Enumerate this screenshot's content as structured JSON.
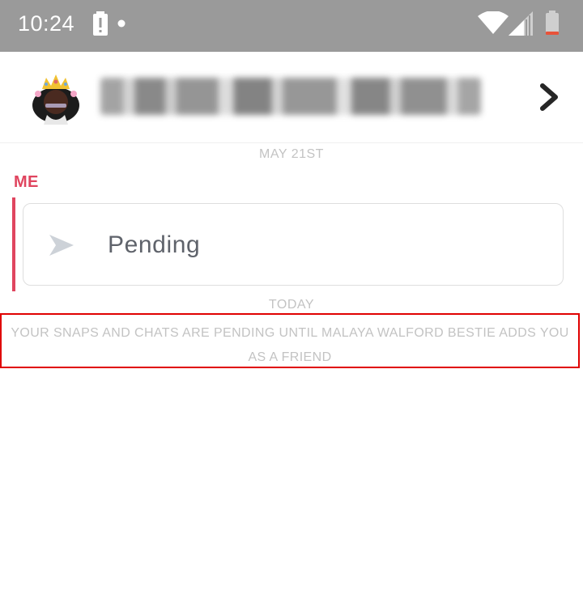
{
  "status_bar": {
    "time": "10:24",
    "icons": [
      "battery-alert-icon",
      "notification-dot-icon",
      "wifi-icon",
      "signal-icon",
      "battery-icon"
    ]
  },
  "header": {
    "avatar_icon": "bitmoji-avatar-icon",
    "contact_name": "Malaya Walford Bestie",
    "name_obscured": true,
    "chevron_icon": "chevron-right-icon"
  },
  "conversation": {
    "date_1": "MAY 21ST",
    "sender": "ME",
    "message": {
      "icon": "sent-arrow-icon",
      "status": "Pending"
    },
    "date_2": "TODAY",
    "notice": "YOUR SNAPS AND CHATS ARE PENDING UNTIL MALAYA WALFORD BESTIE ADDS YOU AS A FRIEND"
  },
  "colors": {
    "status_bar": "#9a9a9a",
    "accent": "#e0455f",
    "muted_text": "#c3c3c3",
    "highlight_border": "#e00000"
  }
}
